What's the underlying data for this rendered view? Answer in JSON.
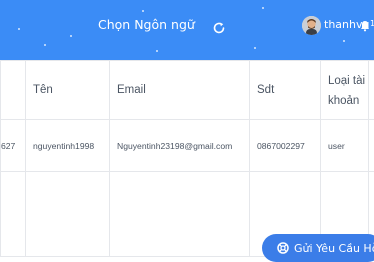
{
  "header": {
    "language_label": "Chọn Ngôn ngữ",
    "username": "thanhvu",
    "notification_count": "1"
  },
  "table": {
    "headers": [
      "",
      "Tên",
      "Email",
      "Sdt",
      "Loại tài khoản",
      ""
    ],
    "rows": [
      [
        "627",
        "nguyentinh1998",
        "Nguyentinh23198@gmail.com",
        "0867002297",
        "user",
        ""
      ]
    ]
  },
  "support_button": {
    "label": "Gửi Yêu Cầu Hỗ"
  },
  "colors": {
    "header_bg": "#3b8cf6",
    "button_bg": "#3b7de8",
    "border": "#e5e7eb",
    "text": "#4b5563"
  }
}
